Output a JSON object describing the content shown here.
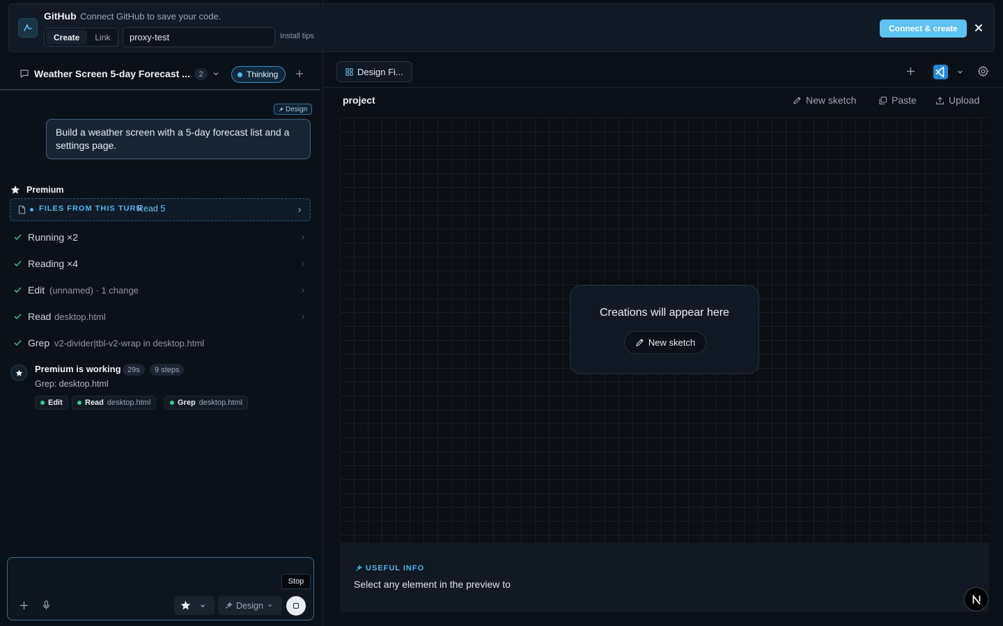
{
  "github_banner": {
    "title": "GitHub",
    "description": "Connect GitHub to save your code.",
    "segment_create": "Create",
    "segment_link": "Link",
    "repo_value": "proxy-test",
    "install_tips": "Install tips",
    "connect_button": "Connect & create",
    "accent_color": "#5ec2f2"
  },
  "chat": {
    "title": "Weather Screen 5-day Forecast ...",
    "count": "2",
    "status": "Thinking",
    "mode_tag": "Design",
    "user_message": "Build a weather screen with a 5-day forecast list and a settings page."
  },
  "agent": {
    "name": "Premium",
    "files_label": "FILES FROM THIS TURN",
    "files_read": "Read 5",
    "steps": [
      {
        "label": "Running ×2",
        "detail": ""
      },
      {
        "label": "Reading ×4",
        "detail": ""
      },
      {
        "label": "Edit",
        "detail": "(unnamed) · 1 change"
      },
      {
        "label": "Read",
        "detail": "desktop.html"
      },
      {
        "label": "Grep",
        "detail": "v2-divider|tbl-v2-wrap in desktop.html"
      }
    ],
    "working": {
      "title": "Premium is working",
      "time": "29s",
      "steps": "9 steps",
      "current": "Grep: desktop.html",
      "chips": [
        {
          "action": "Edit",
          "file": ""
        },
        {
          "action": "Read",
          "file": "desktop.html"
        },
        {
          "action": "Grep",
          "file": "desktop.html"
        }
      ]
    }
  },
  "composer": {
    "stop_tooltip": "Stop",
    "mode_label": "Design"
  },
  "workspace": {
    "tab_label": "Design Fi...",
    "project_title": "project",
    "toolbar": {
      "new_sketch": "New sketch",
      "paste": "Paste",
      "upload": "Upload"
    },
    "empty_state": {
      "title": "Creations will appear here",
      "button": "New sketch"
    },
    "info": {
      "label": "USEFUL INFO",
      "text": "Select any element in the preview to"
    }
  },
  "icons": {
    "logo": "studio-logo-icon",
    "vscode": "vscode-icon",
    "settings": "gear-icon",
    "premium": "star-icon"
  }
}
